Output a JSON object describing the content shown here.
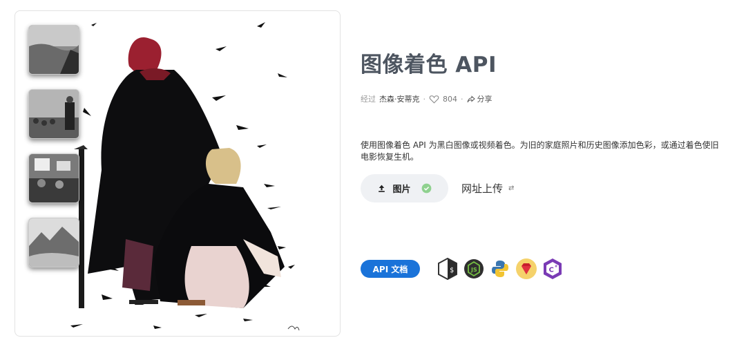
{
  "header": {
    "title": "图像着色 API"
  },
  "meta": {
    "by": "经过",
    "author": "杰森·安蒂克",
    "separator": "·",
    "likes": "804",
    "share": "分享"
  },
  "description": "使用图像着色 API 为黑白图像或视频着色。为旧的家庭照片和历史图像添加色彩，或通过着色使旧电影恢复生机。",
  "upload": {
    "image_label": "图片",
    "url_label": "网址上传"
  },
  "api": {
    "docs_label": "API 文档",
    "languages": [
      "shell-icon",
      "nodejs-icon",
      "python-icon",
      "ruby-icon",
      "csharp-icon"
    ]
  },
  "thumbnails": [
    "landscape-thumb",
    "crowd-speech-thumb",
    "protest-signs-thumb",
    "mountain-mist-thumb"
  ],
  "colors": {
    "accent": "#1a73d9",
    "title": "#4d5560",
    "check": "#8fd18f",
    "ruby_bg": "#f5d26b"
  }
}
